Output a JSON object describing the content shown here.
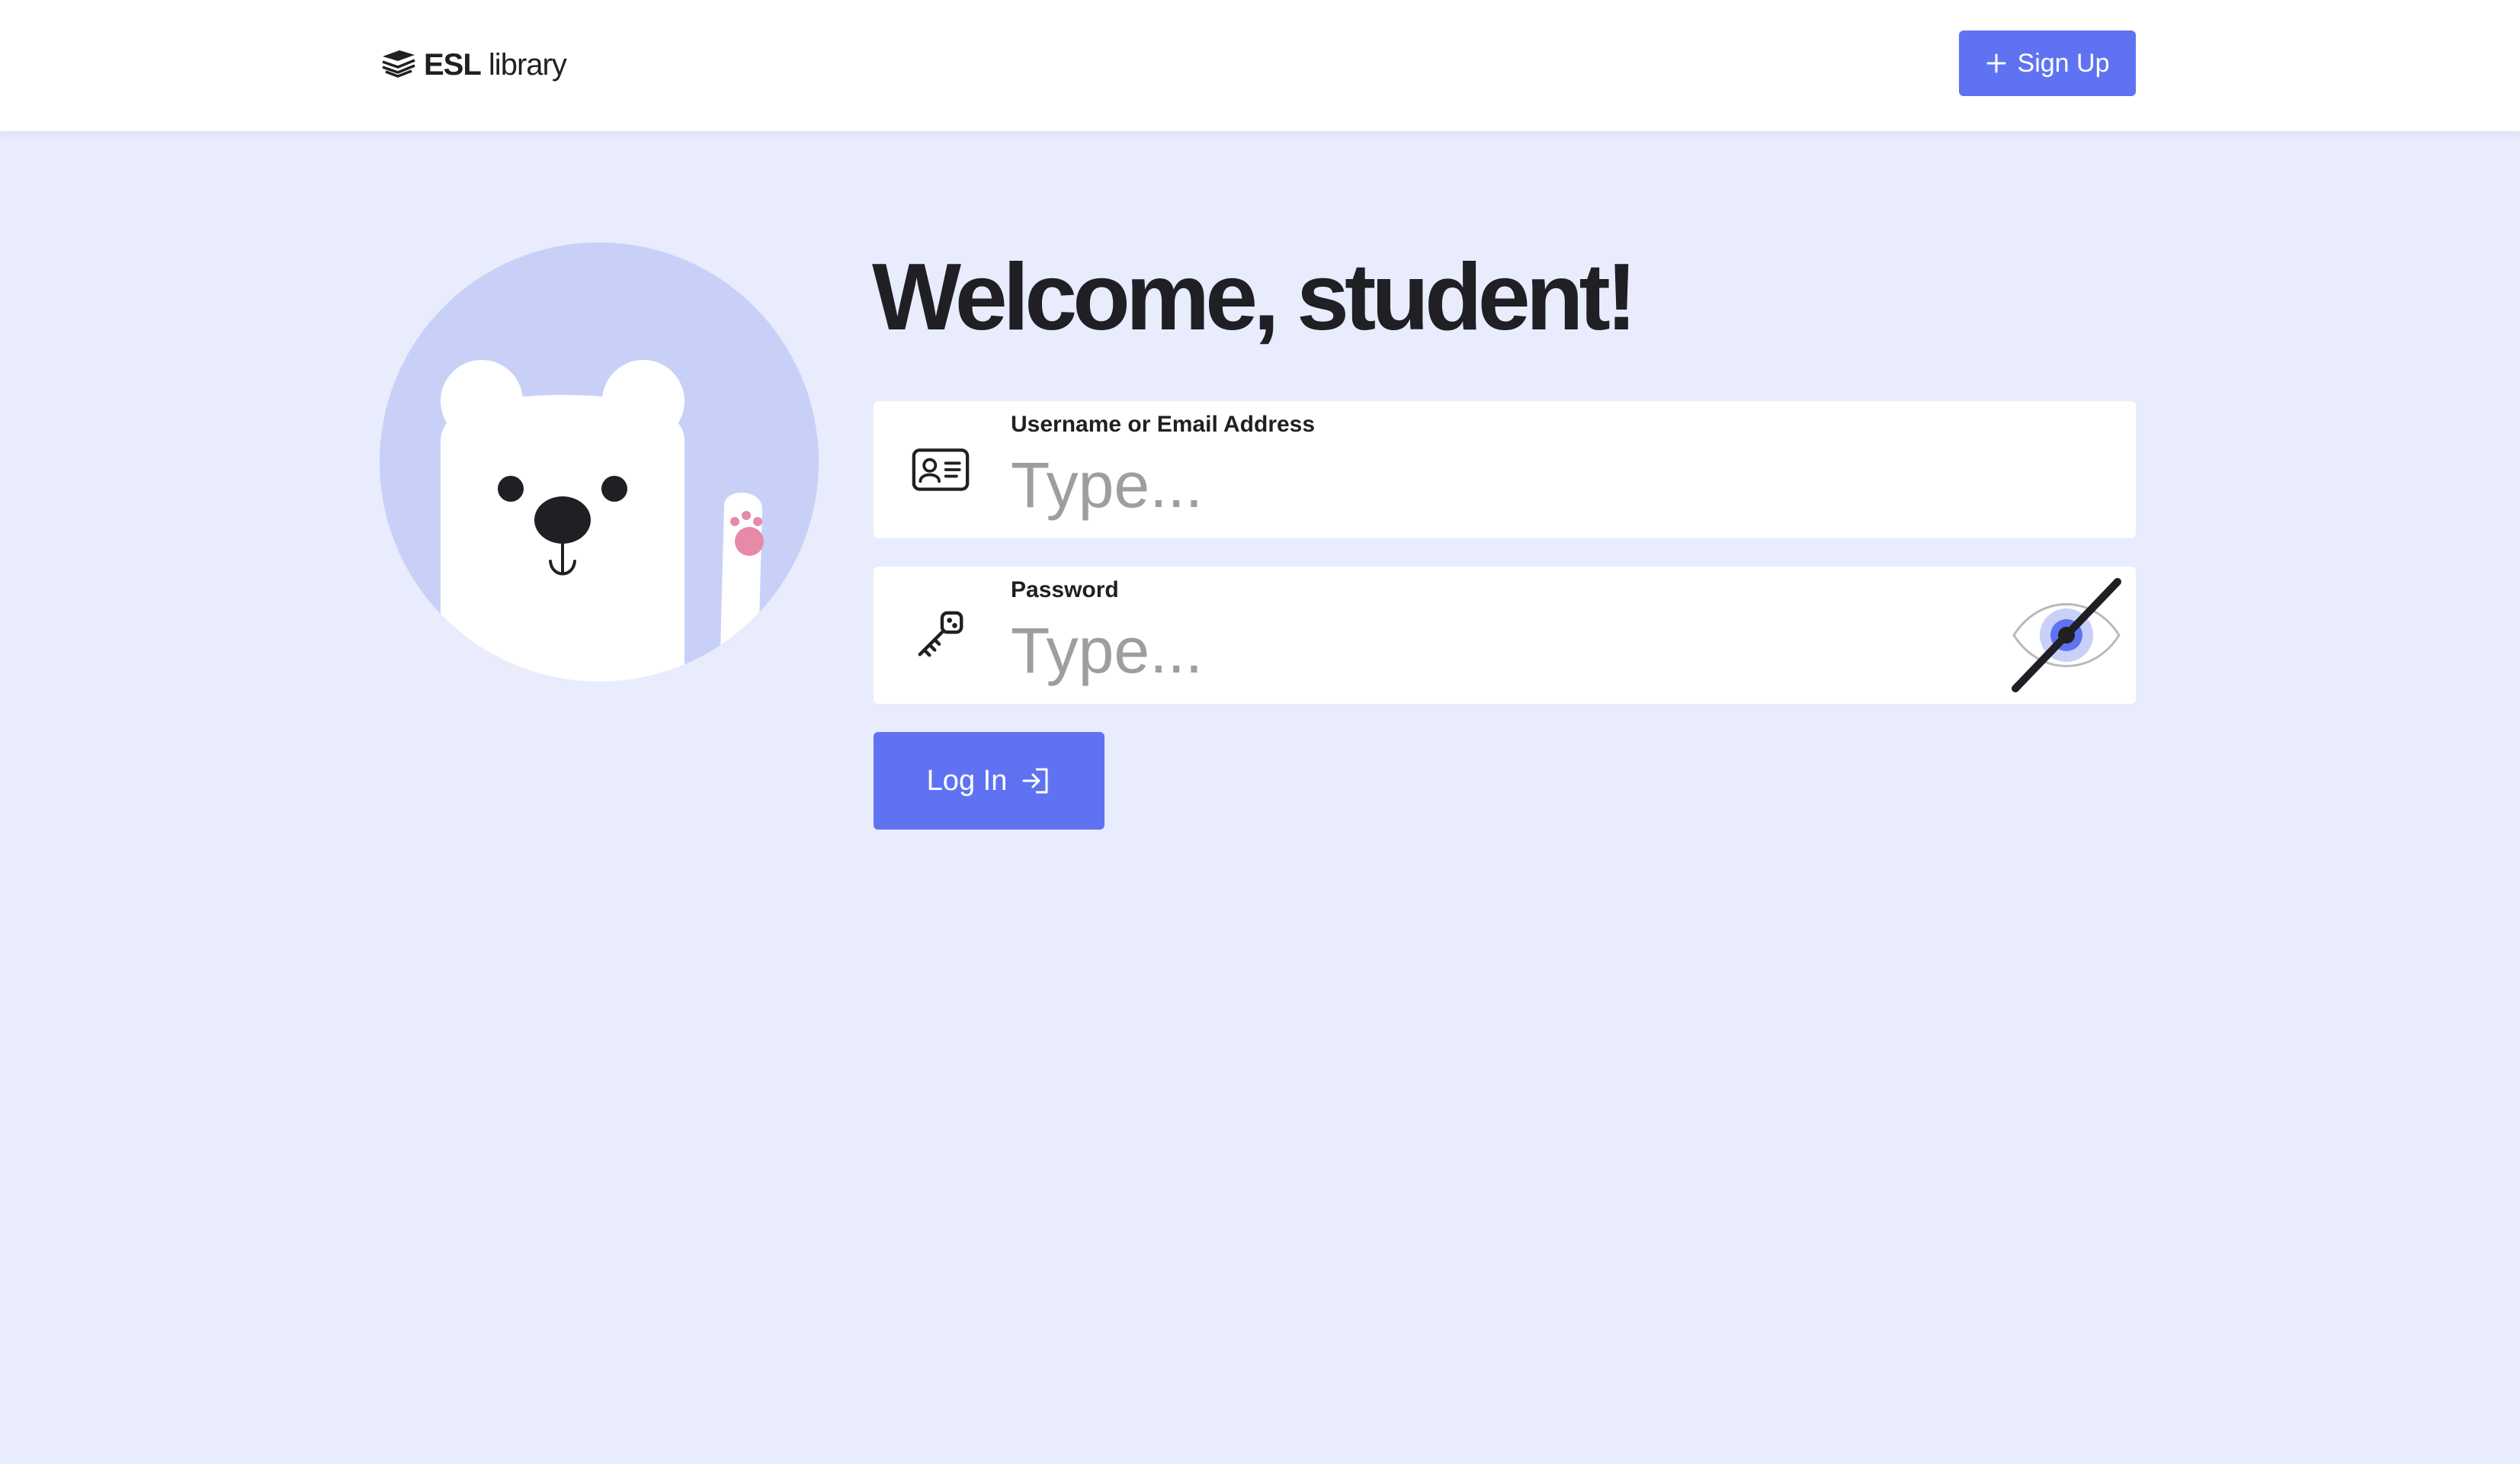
{
  "header": {
    "logo": {
      "text_bold": "ESL",
      "text_regular": "library",
      "icon": "stacked-books-icon"
    },
    "signup_label": "Sign Up",
    "signup_icon": "plus-icon"
  },
  "hero": {
    "illustration": "waving-polar-bear",
    "title": "Welcome, student!"
  },
  "form": {
    "username": {
      "label": "Username or Email Address",
      "placeholder": "Type...",
      "value": "",
      "icon": "id-card-icon"
    },
    "password": {
      "label": "Password",
      "placeholder": "Type...",
      "value": "",
      "icon": "key-icon",
      "toggle_icon": "eye-slash-icon"
    },
    "login_label": "Log In",
    "login_icon": "sign-in-arrow-icon"
  },
  "colors": {
    "page_background": "#e8ecfc",
    "header_background": "#ffffff",
    "accent": "#5f73f2",
    "hero_circle": "#c9d0f8",
    "paw_pink": "#e68aa8",
    "placeholder": "#9e9e9e",
    "text": "#1f1f24"
  }
}
